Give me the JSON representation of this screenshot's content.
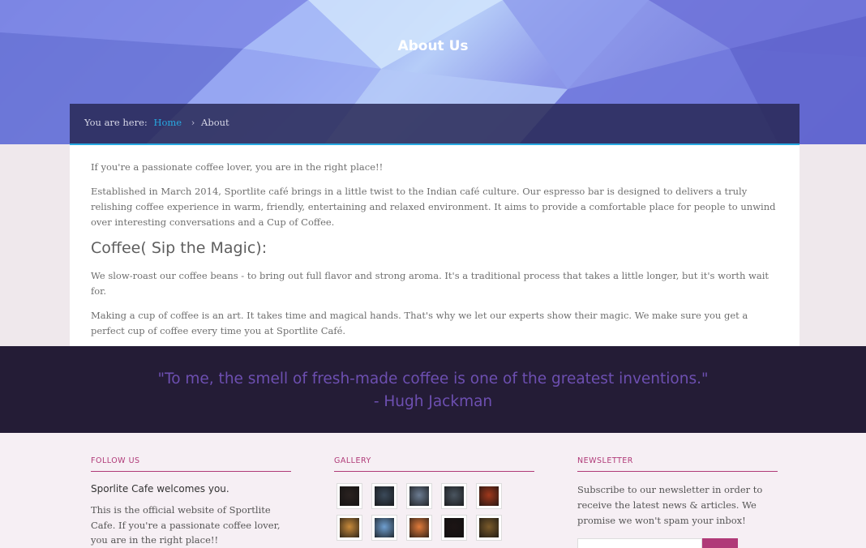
{
  "page": {
    "title": "About Us"
  },
  "breadcrumb": {
    "prefix": "You are here:",
    "home": "Home",
    "separator": "›",
    "current": "About"
  },
  "content": {
    "intro": "If you're a passionate coffee lover, you are in the right place!!",
    "established": "Established in March 2014, Sportlite café brings in a little twist to the Indian café culture. Our espresso bar is designed to delivers a truly relishing coffee experience in warm, friendly, entertaining and relaxed environment. It aims to provide a comfortable place for people to unwind over interesting conversations and a Cup of Coffee.",
    "heading": "Coffee( Sip the Magic):",
    "roast": "We slow-roast our coffee beans - to bring out full flavor and strong aroma. It's a traditional process that takes a little longer, but it's worth wait for.",
    "art": "Making a cup of coffee is an art. It takes time and magical hands. That's why we let our experts show their magic. We make sure you get a perfect cup of coffee every time you at Sportlite Café."
  },
  "quote": {
    "text": "\"To me, the smell of fresh-made coffee is one of the greatest inventions.\"",
    "author": "- Hugh Jackman"
  },
  "footer": {
    "follow": {
      "heading": "FOLLOW US",
      "welcome": "Sporlite Cafe welcomes you.",
      "description": "This is the official website of Sportlite Cafe. If you're a passionate coffee lover, you are in the right place!!"
    },
    "gallery": {
      "heading": "GALLERY",
      "thumbnails": [
        {
          "name": "gallery-thumb-1",
          "color": "#2a2220"
        },
        {
          "name": "gallery-thumb-2",
          "color": "#3b4a5a"
        },
        {
          "name": "gallery-thumb-3",
          "color": "#6c7c92"
        },
        {
          "name": "gallery-thumb-4",
          "color": "#4a5560"
        },
        {
          "name": "gallery-thumb-5",
          "color": "#a0381c"
        },
        {
          "name": "gallery-thumb-6",
          "color": "#c88a3a"
        },
        {
          "name": "gallery-thumb-7",
          "color": "#6f9fd0"
        },
        {
          "name": "gallery-thumb-8",
          "color": "#e07a3a"
        },
        {
          "name": "gallery-thumb-9",
          "color": "#1c1414"
        },
        {
          "name": "gallery-thumb-10",
          "color": "#7a5a2a"
        }
      ]
    },
    "newsletter": {
      "heading": "NEWSLETTER",
      "description": "Subscribe to our newsletter in order to receive the latest news & articles. We promise we won't spam your inbox!"
    }
  },
  "colors": {
    "accent": "#27a9e1",
    "brand": "#b03a78",
    "quote_text": "#6d4fb1",
    "quote_bg": "#241c36"
  }
}
